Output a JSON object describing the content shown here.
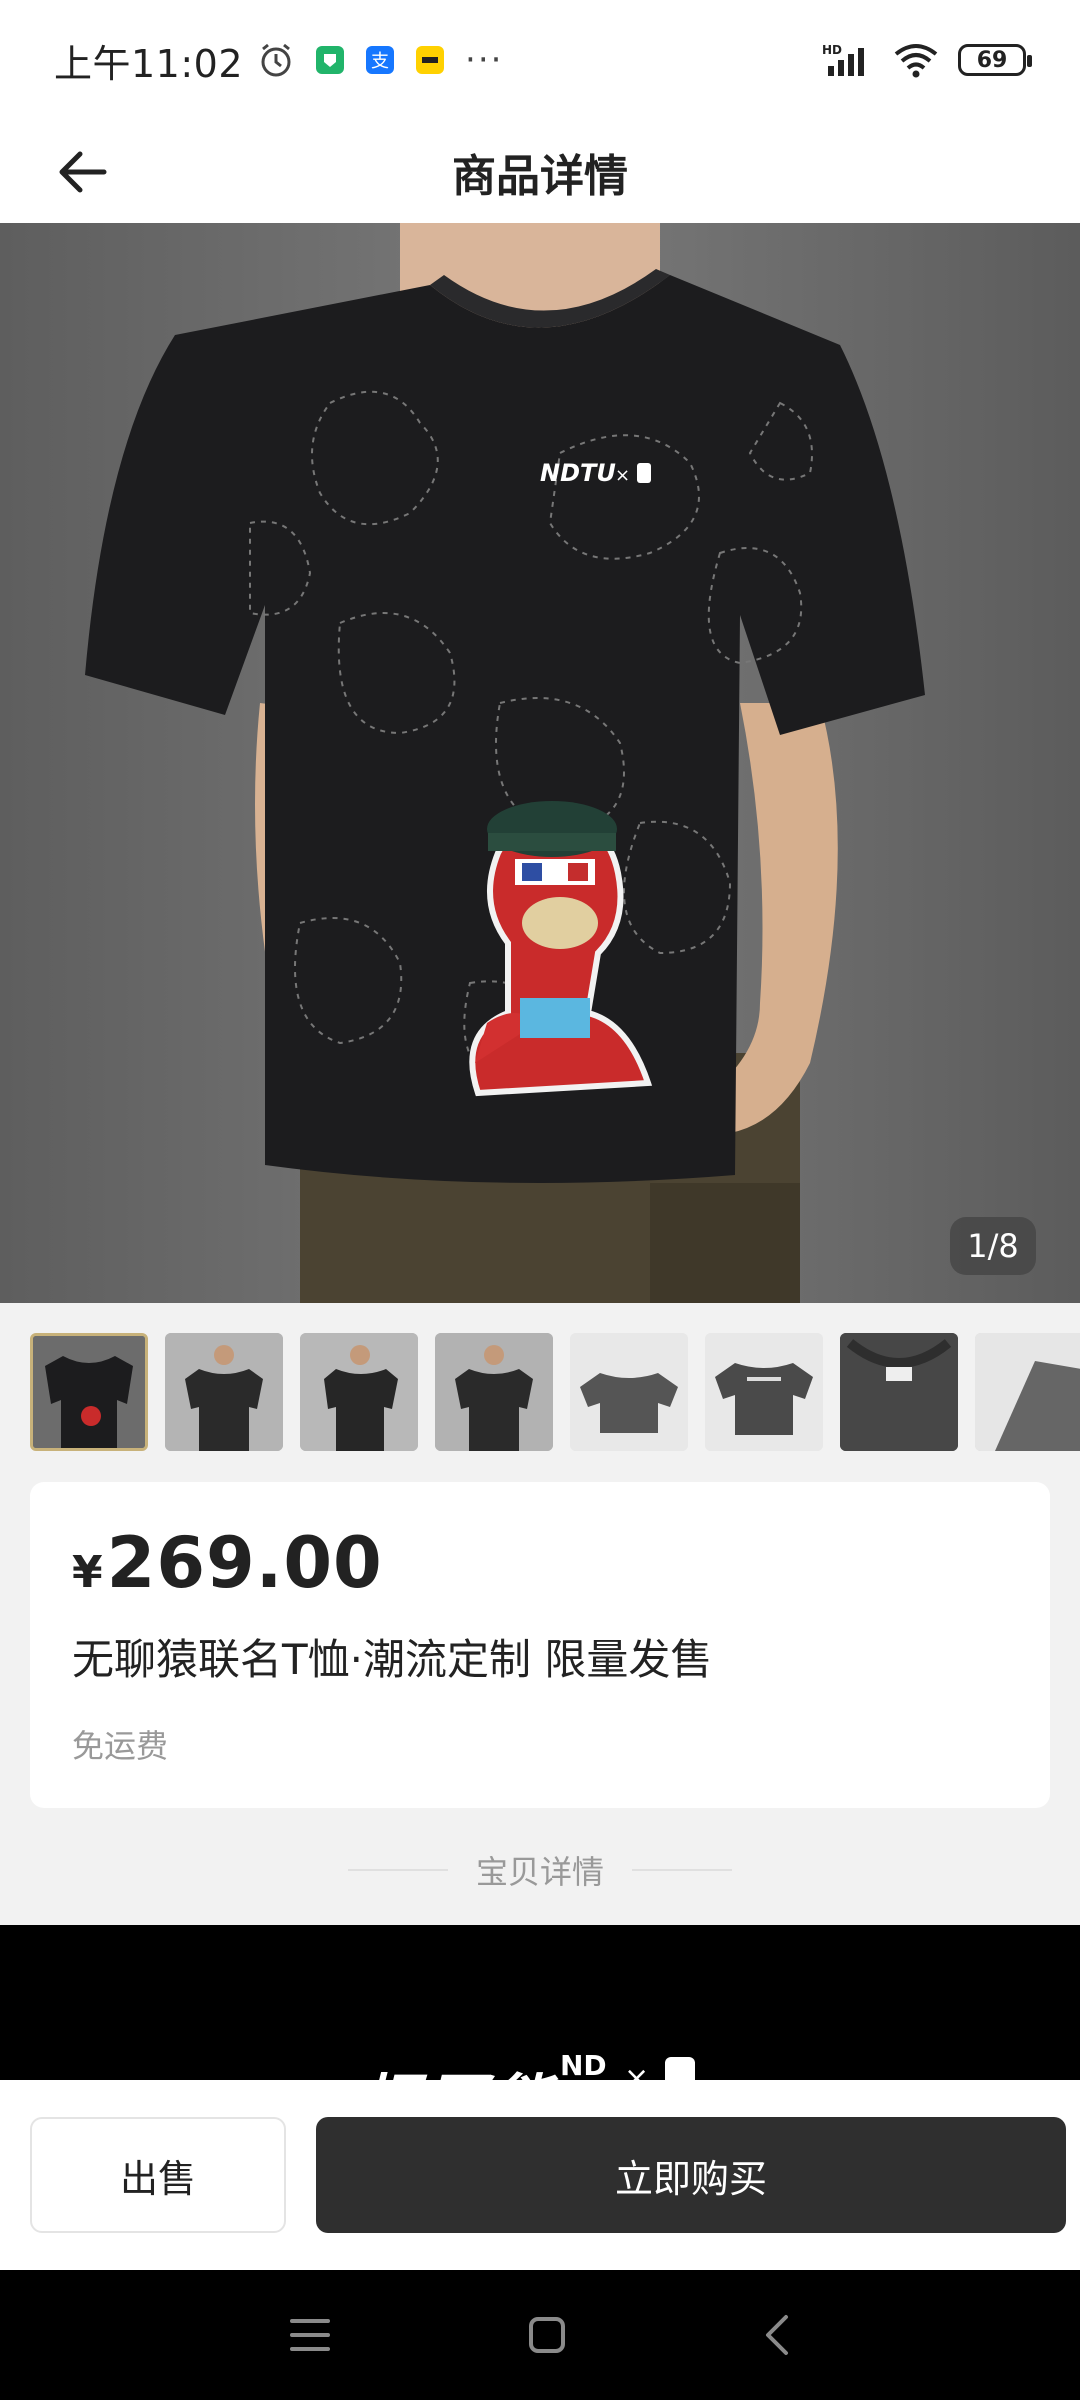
{
  "status_bar": {
    "time": "上午11:02",
    "network": "HD",
    "battery": "69",
    "more": "···"
  },
  "nav": {
    "title": "商品详情"
  },
  "gallery": {
    "counter": "1/8",
    "shirt_logo": "NDTU",
    "shirt_logo_x": "×",
    "thumbnail_count": 8
  },
  "product": {
    "currency": "¥",
    "price": "269.00",
    "title": "无聊猿联名T恤·潮流定制 限量发售",
    "shipping": "免运费"
  },
  "detail_divider": "宝贝详情",
  "detail_banner": {
    "headline": "扭蛋熊",
    "mark": "ND",
    "x": "×"
  },
  "actions": {
    "sell": "出售",
    "buy": "立即购买"
  },
  "colors": {
    "accent": "#2f2f2f",
    "thumb_active_border": "#c8b27a",
    "muted_text": "#999999"
  }
}
